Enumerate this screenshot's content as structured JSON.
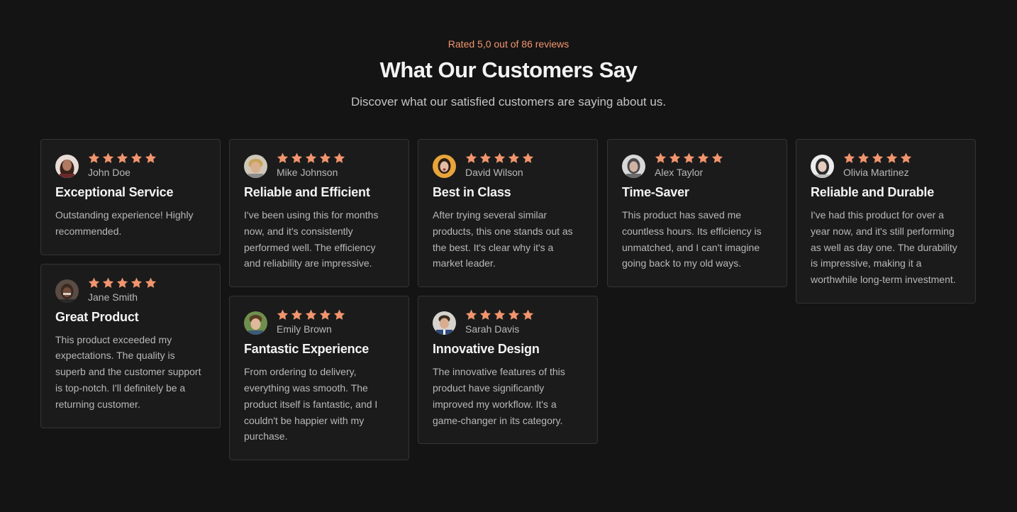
{
  "header": {
    "rating_text": "Rated 5,0 out of 86 reviews",
    "title": "What Our Customers Say",
    "subtitle": "Discover what our satisfied customers are saying about us."
  },
  "colors": {
    "background": "#141414",
    "card_background": "#1b1b1b",
    "card_border": "#343434",
    "accent": "#f2956e",
    "star": "#f2956e"
  },
  "star_rating_max": 5,
  "reviews": [
    {
      "name": "John Doe",
      "stars": 5,
      "title": "Exceptional Service",
      "text": "Outstanding experience! Highly recommended."
    },
    {
      "name": "Jane Smith",
      "stars": 5,
      "title": "Great Product",
      "text": "This product exceeded my expectations. The quality is superb and the customer support is top-notch. I'll definitely be a returning customer."
    },
    {
      "name": "Mike Johnson",
      "stars": 5,
      "title": "Reliable and Efficient",
      "text": "I've been using this for months now, and it's consistently performed well. The efficiency and reliability are impressive."
    },
    {
      "name": "Emily Brown",
      "stars": 5,
      "title": "Fantastic Experience",
      "text": "From ordering to delivery, everything was smooth. The product itself is fantastic, and I couldn't be happier with my purchase."
    },
    {
      "name": "David Wilson",
      "stars": 5,
      "title": "Best in Class",
      "text": "After trying several similar products, this one stands out as the best. It's clear why it's a market leader."
    },
    {
      "name": "Sarah Davis",
      "stars": 5,
      "title": "Innovative Design",
      "text": "The innovative features of this product have significantly improved my workflow. It's a game-changer in its category."
    },
    {
      "name": "Alex Taylor",
      "stars": 5,
      "title": "Time-Saver",
      "text": "This product has saved me countless hours. Its efficiency is unmatched, and I can't imagine going back to my old ways."
    },
    {
      "name": "Olivia Martinez",
      "stars": 5,
      "title": "Reliable and Durable",
      "text": "I've had this product for over a year now, and it's still performing as well as day one. The durability is impressive, making it a worthwhile long-term investment."
    }
  ]
}
